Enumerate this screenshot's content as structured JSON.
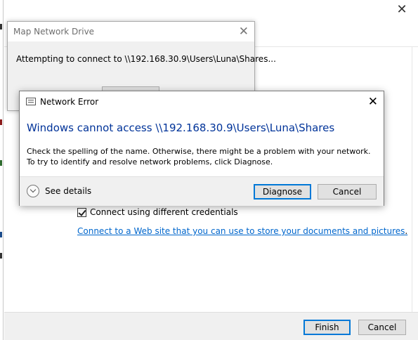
{
  "wizard": {
    "close_glyph": "✕",
    "checkbox_label": "Connect using different credentials",
    "link_text": "Connect to a Web site that you can use to store your documents and pictures",
    "link_suffix": ".",
    "finish_label": "Finish",
    "cancel_label": "Cancel"
  },
  "mapdrive": {
    "title": "Map Network Drive",
    "close_glyph": "✕",
    "message": "Attempting to connect to \\\\192.168.30.9\\Users\\Luna\\Shares..."
  },
  "error": {
    "title": "Network Error",
    "close_glyph": "✕",
    "heading": "Windows cannot access \\\\192.168.30.9\\Users\\Luna\\Shares",
    "body": "Check the spelling of the name. Otherwise, there might be a problem with your network. To try to identify and resolve network problems, click Diagnose.",
    "see_details_label": "See details",
    "diagnose_label": "Diagnose",
    "cancel_label": "Cancel"
  },
  "colors": {
    "heading_blue": "#003399",
    "link_blue": "#0066cc",
    "focus_blue": "#0078d7"
  }
}
